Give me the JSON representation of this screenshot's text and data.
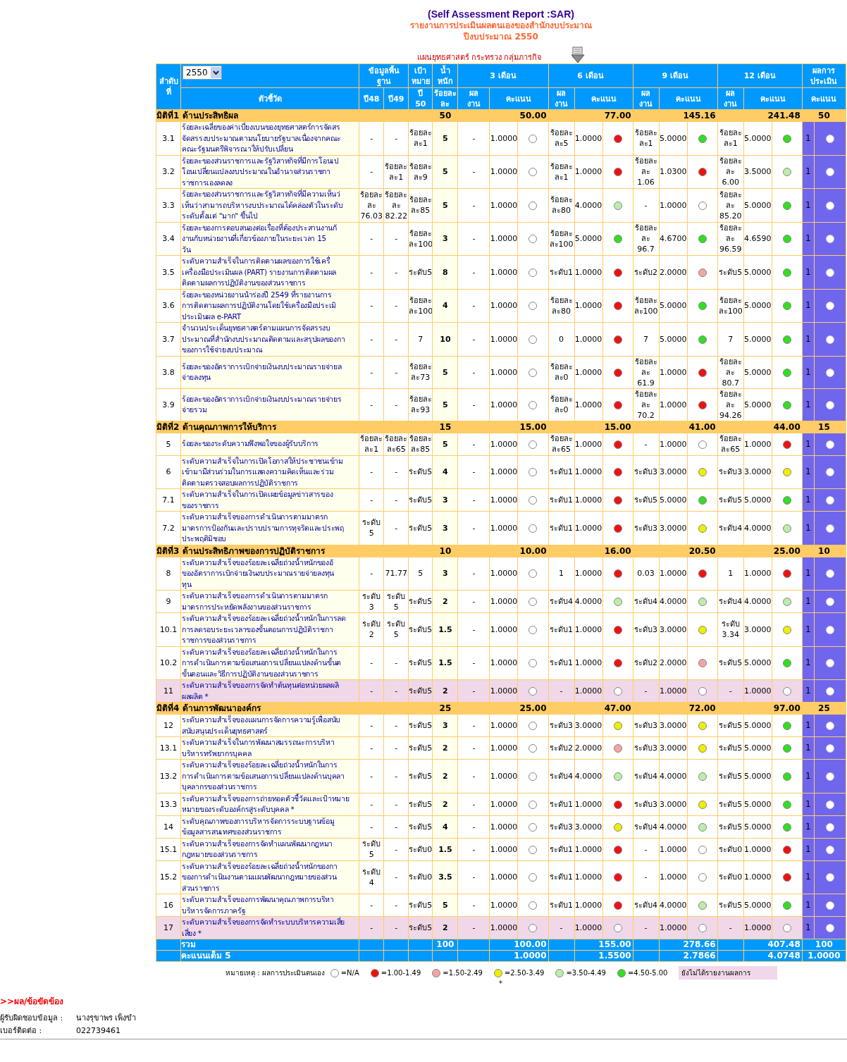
{
  "report": {
    "title": "(Self Assessment Report :SAR)",
    "subtitle": "รายงานการประเมินผลตนเองของสำนักงบประมาณ",
    "fiscal_year": "ปีงบประมาณ 2550",
    "organization": "แผนยุทธศาสตร์ กระทรวง กลุ่มภารกิจ"
  },
  "header": {
    "order": "ลำดับ\nที่",
    "year_select": "2550",
    "indicator": "ตัวชี้วัด",
    "baseline": "ข้อมูลพื้น\nฐาน",
    "baseline_years": [
      "ปี48",
      "ปี49"
    ],
    "target": "เป้า\nหมาย",
    "target_year": "ปี\n50",
    "weight": "น้ำหนัก",
    "weight_unit": "ร้อยละ\nละ",
    "evaluation": "ผลการ\nประเมิน",
    "evaluation_score": "คะแนน",
    "periods": [
      {
        "label": "3 เดือน",
        "result": "ผล\nงาน",
        "score": "คะแนน"
      },
      {
        "label": "6 เดือน",
        "result": "ผล\nงาน",
        "score": "คะแนน"
      },
      {
        "label": "9 เดือน",
        "result": "ผล\nงาน",
        "score": "คะแนน"
      },
      {
        "label": "12 เดือน",
        "result": "ผล\nงาน",
        "score": "คะแนน"
      }
    ]
  },
  "groups": [
    {
      "title": "มิติที่1 ด้านประสิทธิผล",
      "weight": "50",
      "totals": [
        "50.00",
        "77.00",
        "145.16",
        "241.48"
      ],
      "evaluation_total": "50",
      "rows": [
        {
          "no": "3.1",
          "indicator": "ร้อยละเฉลี่ยของค่าเบี่ยงเบนของยุทธศาสตร์การจัดสร\nจัดสรรงบประมาณตามนโยบายรัฐบาลเนื่องจากคณะ\nคณะรัฐมนตรีพิจารณาให้ปรับเปลี่ยน",
          "base_48": "-",
          "base_49": "-",
          "target": "ร้อยละ\nละ1",
          "weight": "5",
          "reported": true,
          "evaluation": "1",
          "evaluation_selected": false,
          "periods": [
            {
              "result": "-",
              "score": "1.0000",
              "color": "#ffffff"
            },
            {
              "result": "ร้อยละ\nละ5",
              "score": "1.0000",
              "color": "#ee1111"
            },
            {
              "result": "ร้อยละ\nละ1",
              "score": "5.0000",
              "color": "#33dd22"
            },
            {
              "result": "ร้อยละ\nละ1",
              "score": "5.0000",
              "color": "#33dd22"
            }
          ]
        },
        {
          "no": "3.2",
          "indicator": "ร้อยละของส่วนราชการและรัฐวิสาหกิจที่มีการโอนเป\nโอนเปลี่ยนแปลงงบประมาณในอำนาจส่วนราชกา\nราชการเองลดลง",
          "base_48": "-",
          "base_49": "ร้อยละ\nละ1",
          "target": "ร้อยละ\nละ9",
          "weight": "5",
          "reported": true,
          "evaluation": "1",
          "evaluation_selected": false,
          "periods": [
            {
              "result": "-",
              "score": "1.0000",
              "color": "#ffffff"
            },
            {
              "result": "ร้อยละ\nละ1",
              "score": "1.0000",
              "color": "#ee1111"
            },
            {
              "result": "ร้อยละ\nละ\n1.06",
              "score": "1.0300",
              "color": "#ee1111"
            },
            {
              "result": "ร้อยละ\nละ\n6.00",
              "score": "3.5000",
              "color": "#bbeeaa"
            }
          ]
        },
        {
          "no": "3.3",
          "indicator": "ร้อยละของส่วนราชการและรัฐวิสาหกิจที่มีความเห็นว่\nเห็นว่าสามารถบริหารงบประมาณได้คล่องตัวในระดับ\nระดับตั้งแต่ \"มาก\" ขึ้นไป",
          "base_48": "ร้อยละ\nละ\n76.03",
          "base_49": "ร้อยละ\nละ\n82.22",
          "target": "ร้อยละ\nละ85",
          "weight": "5",
          "reported": true,
          "evaluation": "1",
          "evaluation_selected": false,
          "periods": [
            {
              "result": "-",
              "score": "1.0000",
              "color": "#ffffff"
            },
            {
              "result": "ร้อยละ\nละ80",
              "score": "4.0000",
              "color": "#bbeeaa"
            },
            {
              "result": "-",
              "score": "1.0000",
              "color": "#ffffff"
            },
            {
              "result": "ร้อยละ\nละ\n85.20",
              "score": "5.0000",
              "color": "#33dd22"
            }
          ]
        },
        {
          "no": "3.4",
          "indicator": "ร้อยละของการตอบสนองต่อเรื่องที่ต้องประสานงานกั\nงานกับหน่วยงานที่เกี่ยวข้องภายในระยะเวลา 15\nวัน",
          "base_48": "-",
          "base_49": "-",
          "target": "ร้อยละ\nละ100",
          "weight": "3",
          "reported": true,
          "evaluation": "1",
          "evaluation_selected": false,
          "periods": [
            {
              "result": "-",
              "score": "1.0000",
              "color": "#ffffff"
            },
            {
              "result": "ร้อยละ\nละ100",
              "score": "5.0000",
              "color": "#33dd22"
            },
            {
              "result": "ร้อยละ\nละ\n96.7",
              "score": "4.6700",
              "color": "#33dd22"
            },
            {
              "result": "ร้อยละ\nละ\n96.59",
              "score": "4.6590",
              "color": "#33dd22"
            }
          ]
        },
        {
          "no": "3.5",
          "indicator": "ระดับความสำเร็จในการติดตามผลของการใช้เครื่\nเครื่องมือประเมินผล (PART) รายงานการติดตามผล\nติดตามผลการปฏิบัติงานของส่วนราชการ",
          "base_48": "-",
          "base_49": "-",
          "target": "ระดับ5",
          "weight": "8",
          "reported": true,
          "evaluation": "1",
          "evaluation_selected": false,
          "periods": [
            {
              "result": "-",
              "score": "1.0000",
              "color": "#ffffff"
            },
            {
              "result": "ระดับ1",
              "score": "1.0000",
              "color": "#ee1111"
            },
            {
              "result": "ระดับ2",
              "score": "2.0000",
              "color": "#f4a4a4"
            },
            {
              "result": "ระดับ5",
              "score": "5.0000",
              "color": "#33dd22"
            }
          ]
        },
        {
          "no": "3.6",
          "indicator": "ร้อยละของหน่วยงานนำร่องปี 2549 ที่รายงานการ\nการติดตามผลการปฏิบัติงานโดยใช้เครื่องมือประเมิ\nประเมินผล e-PART",
          "base_48": "-",
          "base_49": "-",
          "target": "ร้อยละ\nละ100",
          "weight": "4",
          "reported": true,
          "evaluation": "1",
          "evaluation_selected": false,
          "periods": [
            {
              "result": "-",
              "score": "1.0000",
              "color": "#ffffff"
            },
            {
              "result": "ร้อยละ\nละ80",
              "score": "1.0000",
              "color": "#ee1111"
            },
            {
              "result": "ร้อยละ\nละ100",
              "score": "5.0000",
              "color": "#33dd22"
            },
            {
              "result": "ร้อยละ\nละ100",
              "score": "5.0000",
              "color": "#33dd22"
            }
          ]
        },
        {
          "no": "3.7",
          "indicator": "จำนวนประเด็นยุทธศาสตร์ตามแผนการจัดสรรงบ\nประมาณที่สำนักงบประมาณติดตามและสรุปผลของกา\nของการใช้จ่ายงบประมาณ",
          "base_48": "-",
          "base_49": "-",
          "target": "7",
          "weight": "10",
          "reported": true,
          "evaluation": "1",
          "evaluation_selected": false,
          "periods": [
            {
              "result": "-",
              "score": "1.0000",
              "color": "#ffffff"
            },
            {
              "result": "0",
              "score": "1.0000",
              "color": "#ee1111"
            },
            {
              "result": "7",
              "score": "5.0000",
              "color": "#33dd22"
            },
            {
              "result": "7",
              "score": "5.0000",
              "color": "#33dd22"
            }
          ]
        },
        {
          "no": "3.8",
          "indicator": "ร้อยละของอัตราการเบิกจ่ายเงินงบประมาณรายจ่ายล\nจ่ายลงทุน",
          "base_48": "-",
          "base_49": "-",
          "target": "ร้อยละ\nละ73",
          "weight": "5",
          "reported": true,
          "evaluation": "1",
          "evaluation_selected": false,
          "periods": [
            {
              "result": "-",
              "score": "1.0000",
              "color": "#ffffff"
            },
            {
              "result": "ร้อยละ\nละ0",
              "score": "1.0000",
              "color": "#ee1111"
            },
            {
              "result": "ร้อยละ\nละ\n61.9",
              "score": "1.0000",
              "color": "#ee1111"
            },
            {
              "result": "ร้อยละ\nละ\n80.7",
              "score": "5.0000",
              "color": "#33dd22"
            }
          ]
        },
        {
          "no": "3.9",
          "indicator": "ร้อยละของอัตราการเบิกจ่ายเงินงบประมาณรายจ่ายร\nจ่ายรวม",
          "base_48": "-",
          "base_49": "-",
          "target": "ร้อยละ\nละ93",
          "weight": "5",
          "reported": true,
          "evaluation": "1",
          "evaluation_selected": false,
          "periods": [
            {
              "result": "-",
              "score": "1.0000",
              "color": "#ffffff"
            },
            {
              "result": "ร้อยละ\nละ0",
              "score": "1.0000",
              "color": "#ee1111"
            },
            {
              "result": "ร้อยละ\nละ\n70.2",
              "score": "1.0000",
              "color": "#ee1111"
            },
            {
              "result": "ร้อยละ\nละ\n94.26",
              "score": "5.0000",
              "color": "#33dd22"
            }
          ]
        }
      ]
    },
    {
      "title": "มิติที่2 ด้านคุณภาพการให้บริการ",
      "weight": "15",
      "totals": [
        "15.00",
        "15.00",
        "41.00",
        "44.00"
      ],
      "evaluation_total": "15",
      "rows": [
        {
          "no": "5",
          "indicator": "ร้อยละของระดับความพึงพอใจของผู้รับบริการ",
          "base_48": "ร้อยละ\nละ1",
          "base_49": "ร้อยละ\nละ65",
          "target": "ร้อยละ\nละ85",
          "weight": "5",
          "reported": true,
          "evaluation": "1",
          "evaluation_selected": false,
          "periods": [
            {
              "result": "-",
              "score": "1.0000",
              "color": "#ffffff"
            },
            {
              "result": "ร้อยละ\nละ65",
              "score": "1.0000",
              "color": "#ee1111"
            },
            {
              "result": "-",
              "score": "1.0000",
              "color": "#ffffff"
            },
            {
              "result": "ร้อยละ\nละ65",
              "score": "1.0000",
              "color": "#ee1111"
            }
          ]
        },
        {
          "no": "6",
          "indicator": "ระดับความสำเร็จในการเปิดโอกาสให้ประชาชนเข้าม\nเข้ามามีส่วนร่วมในการแสดงความคิดเห็นและร่วม\nติดตามตรวจสอบผลการปฏิบัติราชการ",
          "base_48": "-",
          "base_49": "-",
          "target": "ระดับ5",
          "weight": "4",
          "reported": true,
          "evaluation": "1",
          "evaluation_selected": false,
          "periods": [
            {
              "result": "-",
              "score": "1.0000",
              "color": "#ffffff"
            },
            {
              "result": "ระดับ1",
              "score": "1.0000",
              "color": "#ee1111"
            },
            {
              "result": "ระดับ3",
              "score": "3.0000",
              "color": "#eeee00"
            },
            {
              "result": "ระดับ3",
              "score": "3.0000",
              "color": "#eeee00"
            }
          ]
        },
        {
          "no": "7.1",
          "indicator": "ระดับความสำเร็จในการเปิดเผยข้อมูลข่าวสารของ\nของราชการ",
          "base_48": "-",
          "base_49": "-",
          "target": "ระดับ5",
          "weight": "3",
          "reported": true,
          "evaluation": "1",
          "evaluation_selected": false,
          "periods": [
            {
              "result": "-",
              "score": "1.0000",
              "color": "#ffffff"
            },
            {
              "result": "ระดับ1",
              "score": "1.0000",
              "color": "#ee1111"
            },
            {
              "result": "ระดับ5",
              "score": "5.0000",
              "color": "#33dd22"
            },
            {
              "result": "ระดับ5",
              "score": "5.0000",
              "color": "#33dd22"
            }
          ]
        },
        {
          "no": "7.2",
          "indicator": "ระดับความสำเร็จของการดำเนินการตามมาตรก\nมาตรการป้องกันและปราบปรามการทุจริตและประพฤ\nประพฤติมิชอบ",
          "base_48": "ระดับ\n5",
          "base_49": "-",
          "target": "ระดับ5",
          "weight": "3",
          "reported": true,
          "evaluation": "1",
          "evaluation_selected": false,
          "periods": [
            {
              "result": "-",
              "score": "1.0000",
              "color": "#ffffff"
            },
            {
              "result": "ระดับ1",
              "score": "1.0000",
              "color": "#ee1111"
            },
            {
              "result": "ระดับ3",
              "score": "3.0000",
              "color": "#eeee00"
            },
            {
              "result": "ระดับ4",
              "score": "4.0000",
              "color": "#bbeeaa"
            }
          ]
        }
      ]
    },
    {
      "title": "มิติที่3 ด้านประสิทธิภาพของการปฏิบัติราชการ",
      "weight": "10",
      "totals": [
        "10.00",
        "16.00",
        "20.50",
        "25.00"
      ],
      "evaluation_total": "10",
      "rows": [
        {
          "no": "8",
          "indicator": "ระดับความสำเร็จของร้อยละเฉลี่ยถ่วงน้ำหนักของอั\nของอัตราการเบิกจ่ายเงินงบประมาณรายจ่ายลงทุน\nทุน",
          "base_48": "-",
          "base_49": "71.77",
          "target": "5",
          "weight": "3",
          "reported": true,
          "evaluation": "1",
          "evaluation_selected": false,
          "periods": [
            {
              "result": "-",
              "score": "1.0000",
              "color": "#ffffff"
            },
            {
              "result": "1",
              "score": "1.0000",
              "color": "#ee1111"
            },
            {
              "result": "0.03",
              "score": "1.0000",
              "color": "#ee1111"
            },
            {
              "result": "1",
              "score": "1.0000",
              "color": "#ee1111"
            }
          ]
        },
        {
          "no": "9",
          "indicator": "ระดับความสำเร็จของการดำเนินการตามมาตรก\nมาตรการประหยัดพลังงานของส่วนราชการ",
          "base_48": "ระดับ\n3",
          "base_49": "ระดับ\n5",
          "target": "ระดับ5",
          "weight": "2",
          "reported": true,
          "evaluation": "1",
          "evaluation_selected": false,
          "periods": [
            {
              "result": "-",
              "score": "1.0000",
              "color": "#ffffff"
            },
            {
              "result": "ระดับ4",
              "score": "4.0000",
              "color": "#bbeeaa"
            },
            {
              "result": "ระดับ4",
              "score": "4.0000",
              "color": "#bbeeaa"
            },
            {
              "result": "ระดับ4",
              "score": "4.0000",
              "color": "#bbeeaa"
            }
          ]
        },
        {
          "no": "10.1",
          "indicator": "ระดับความสำเร็จของร้อยละเฉลี่ยถ่วงน้ำหนักในการลด\nการลดรอบระยะเวลาของขั้นตอนการปฏิบัติราชกา\nราชการของส่วนราชการ",
          "base_48": "ระดับ\n2",
          "base_49": "ระดับ\n5",
          "target": "ระดับ5",
          "weight": "1.5",
          "reported": true,
          "evaluation": "1",
          "evaluation_selected": false,
          "periods": [
            {
              "result": "-",
              "score": "1.0000",
              "color": "#ffffff"
            },
            {
              "result": "ระดับ1",
              "score": "1.0000",
              "color": "#ee1111"
            },
            {
              "result": "ระดับ3",
              "score": "3.0000",
              "color": "#eeee00"
            },
            {
              "result": "ระดับ\n3.34",
              "score": "3.0000",
              "color": "#eeee00"
            }
          ]
        },
        {
          "no": "10.2",
          "indicator": "ระดับความสำเร็จของร้อยละเฉลี่ยถ่วงน้ำหนักในการ\nการดำเนินการตามข้อเสนอการเปลี่ยนแปลงด้านขั้นต\nขั้นตอนและวิธีการปฏิบัติงานของส่วนราชการ",
          "base_48": "-",
          "base_49": "-",
          "target": "ระดับ5",
          "weight": "1.5",
          "reported": true,
          "evaluation": "1",
          "evaluation_selected": false,
          "periods": [
            {
              "result": "-",
              "score": "1.0000",
              "color": "#ffffff"
            },
            {
              "result": "ระดับ1",
              "score": "1.0000",
              "color": "#ee1111"
            },
            {
              "result": "ระดับ2",
              "score": "2.0000",
              "color": "#f4a4a4"
            },
            {
              "result": "ระดับ5",
              "score": "5.0000",
              "color": "#33dd22"
            }
          ]
        },
        {
          "no": "11",
          "indicator": "ระดับความสำเร็จของการจัดทำต้นทุนต่อหน่วยผลผลิ\nผลผลิต *",
          "base_48": "-",
          "base_49": "-",
          "target": "ระดับ5",
          "weight": "2",
          "reported": false,
          "evaluation": "1",
          "evaluation_selected": false,
          "periods": [
            {
              "result": "-",
              "score": "1.0000",
              "color": "#ffffff"
            },
            {
              "result": "-",
              "score": "1.0000",
              "color": "#ffffff"
            },
            {
              "result": "-",
              "score": "1.0000",
              "color": "#ffffff"
            },
            {
              "result": "-",
              "score": "1.0000",
              "color": "#ffffff"
            }
          ]
        }
      ]
    },
    {
      "title": "มิติที่4 ด้านการพัฒนาองค์กร",
      "weight": "25",
      "totals": [
        "25.00",
        "47.00",
        "72.00",
        "97.00"
      ],
      "evaluation_total": "25",
      "rows": [
        {
          "no": "12",
          "indicator": "ระดับความสำเร็จของแผนการจัดการความรู้เพื่อสนับ\nสนับสนุนประเด็นยุทธศาสตร์",
          "base_48": "-",
          "base_49": "-",
          "target": "ระดับ5",
          "weight": "3",
          "reported": true,
          "evaluation": "1",
          "evaluation_selected": false,
          "periods": [
            {
              "result": "-",
              "score": "1.0000",
              "color": "#ffffff"
            },
            {
              "result": "ระดับ3",
              "score": "3.0000",
              "color": "#eeee00"
            },
            {
              "result": "ระดับ3",
              "score": "3.0000",
              "color": "#eeee00"
            },
            {
              "result": "ระดับ5",
              "score": "5.0000",
              "color": "#33dd22"
            }
          ]
        },
        {
          "no": "13.1",
          "indicator": "ระดับความสำเร็จในการพัฒนาสมรรถนะการบริหา\nบริหารทรัพยากรบุคคล",
          "base_48": "-",
          "base_49": "-",
          "target": "ระดับ5",
          "weight": "2",
          "reported": true,
          "evaluation": "1",
          "evaluation_selected": false,
          "periods": [
            {
              "result": "-",
              "score": "1.0000",
              "color": "#ffffff"
            },
            {
              "result": "ระดับ2",
              "score": "2.0000",
              "color": "#f4a4a4"
            },
            {
              "result": "ระดับ3",
              "score": "3.0000",
              "color": "#eeee00"
            },
            {
              "result": "ระดับ5",
              "score": "5.0000",
              "color": "#33dd22"
            }
          ]
        },
        {
          "no": "13.2",
          "indicator": "ระดับความสำเร็จของร้อยละเฉลี่ยถ่วงน้ำหนักในการ\nการดำเนินการตามข้อเสนอการเปลี่ยนแปลงด้านบุคลา\nบุคลากรของส่วนราชการ",
          "base_48": "-",
          "base_49": "-",
          "target": "ระดับ5",
          "weight": "2",
          "reported": true,
          "evaluation": "1",
          "evaluation_selected": false,
          "periods": [
            {
              "result": "-",
              "score": "1.0000",
              "color": "#ffffff"
            },
            {
              "result": "ระดับ4",
              "score": "4.0000",
              "color": "#bbeeaa"
            },
            {
              "result": "ระดับ4",
              "score": "4.0000",
              "color": "#bbeeaa"
            },
            {
              "result": "ระดับ5",
              "score": "5.0000",
              "color": "#33dd22"
            }
          ]
        },
        {
          "no": "13.3",
          "indicator": "ระดับความสำเร็จของการถ่ายทอดตัวชี้วัดและเป้าหมาย\nหมายของระดับองค์กรสู่ระดับบุคคล *",
          "base_48": "-",
          "base_49": "-",
          "target": "ระดับ5",
          "weight": "2",
          "reported": true,
          "evaluation": "1",
          "evaluation_selected": false,
          "periods": [
            {
              "result": "-",
              "score": "1.0000",
              "color": "#ffffff"
            },
            {
              "result": "ระดับ1",
              "score": "1.0000",
              "color": "#ee1111"
            },
            {
              "result": "ระดับ3",
              "score": "3.0000",
              "color": "#eeee00"
            },
            {
              "result": "ระดับ5",
              "score": "5.0000",
              "color": "#33dd22"
            }
          ]
        },
        {
          "no": "14",
          "indicator": "ระดับคุณภาพของการบริหารจัดการระบบฐานข้อมู\nข้อมูลสารสนเทศของส่วนราชการ",
          "base_48": "-",
          "base_49": "-",
          "target": "ระดับ5",
          "weight": "4",
          "reported": true,
          "evaluation": "1",
          "evaluation_selected": false,
          "periods": [
            {
              "result": "-",
              "score": "1.0000",
              "color": "#ffffff"
            },
            {
              "result": "ระดับ3",
              "score": "3.0000",
              "color": "#eeee00"
            },
            {
              "result": "ระดับ4",
              "score": "4.0000",
              "color": "#bbeeaa"
            },
            {
              "result": "ระดับ5",
              "score": "5.0000",
              "color": "#33dd22"
            }
          ]
        },
        {
          "no": "15.1",
          "indicator": "ระดับความสำเร็จของการจัดทำแผนพัฒนากฎหมา\nกฎหมายของส่วนราชการ",
          "base_48": "ระดับ\n5",
          "base_49": "-",
          "target": "ระดับ0",
          "weight": "1.5",
          "reported": true,
          "evaluation": "1",
          "evaluation_selected": false,
          "periods": [
            {
              "result": "-",
              "score": "1.0000",
              "color": "#ffffff"
            },
            {
              "result": "ระดับ1",
              "score": "1.0000",
              "color": "#ee1111"
            },
            {
              "result": "-",
              "score": "1.0000",
              "color": "#ffffff"
            },
            {
              "result": "ระดับ0",
              "score": "1.0000",
              "color": "#ee1111"
            }
          ]
        },
        {
          "no": "15.2",
          "indicator": "ระดับความสำเร็จของร้อยละเฉลี่ยถ่วงน้ำหนักของกา\nของการดำเนินงานตามแผนพัฒนากฎหมายของส่วน\nส่วนราชการ",
          "base_48": "ระดับ\n4",
          "base_49": "-",
          "target": "ระดับ0",
          "weight": "3.5",
          "reported": true,
          "evaluation": "1",
          "evaluation_selected": false,
          "periods": [
            {
              "result": "-",
              "score": "1.0000",
              "color": "#ffffff"
            },
            {
              "result": "ระดับ1",
              "score": "1.0000",
              "color": "#ee1111"
            },
            {
              "result": "-",
              "score": "1.0000",
              "color": "#ffffff"
            },
            {
              "result": "ระดับ0",
              "score": "1.0000",
              "color": "#ee1111"
            }
          ]
        },
        {
          "no": "16",
          "indicator": "ระดับความสำเร็จของการพัฒนาคุณภาพการบริหา\nบริหารจัดการภาครัฐ",
          "base_48": "-",
          "base_49": "-",
          "target": "ระดับ5",
          "weight": "5",
          "reported": true,
          "evaluation": "1",
          "evaluation_selected": false,
          "periods": [
            {
              "result": "-",
              "score": "1.0000",
              "color": "#ffffff"
            },
            {
              "result": "ระดับ1",
              "score": "1.0000",
              "color": "#ee1111"
            },
            {
              "result": "ระดับ4",
              "score": "4.0000",
              "color": "#bbeeaa"
            },
            {
              "result": "ระดับ5",
              "score": "5.0000",
              "color": "#33dd22"
            }
          ]
        },
        {
          "no": "17",
          "indicator": "ระดับความสำเร็จของการจัดทำระบบบริหารความเสี่ย\nเสี่ยง *",
          "base_48": "-",
          "base_49": "-",
          "target": "ระดับ5",
          "weight": "2",
          "reported": false,
          "evaluation": "1",
          "evaluation_selected": false,
          "periods": [
            {
              "result": "-",
              "score": "1.0000",
              "color": "#ffffff"
            },
            {
              "result": "-",
              "score": "1.0000",
              "color": "#ffffff"
            },
            {
              "result": "-",
              "score": "1.0000",
              "color": "#ffffff"
            },
            {
              "result": "-",
              "score": "1.0000",
              "color": "#ffffff"
            }
          ]
        }
      ]
    }
  ],
  "totals": [
    {
      "label": "รวม",
      "weight": "100",
      "periods": [
        "100.00",
        "155.00",
        "278.66",
        "407.48"
      ],
      "evaluation": "100"
    },
    {
      "label": "คะแนนเต็ม 5",
      "periods": [
        "1.0000",
        "1.5500",
        "2.7866",
        "4.0748"
      ],
      "evaluation": "1.0000"
    }
  ],
  "legend": {
    "label": "หมายเหตุ : ผลการประเมินตนเอง",
    "items": [
      {
        "label": "=N/A",
        "color": "#ffffff"
      },
      {
        "label": "=1.00-1.49",
        "color": "#ee1111"
      },
      {
        "label": "=1.50-2.49",
        "color": "#f4a4a4"
      },
      {
        "label": "=2.50-3.49",
        "color": "#eeee00"
      },
      {
        "label": "=3.50-4.49",
        "color": "#bbeeaa"
      },
      {
        "label": "=4.50-5.00",
        "color": "#33dd22"
      }
    ],
    "not_reported": "ยังไม่ได้รายงานผลการ",
    "footnote": "*"
  },
  "contact": {
    "heading": ">>ผล/ข้อขัดข้อง",
    "fields": [
      {
        "label": "ผู้รับผิดชอบข้อมูล :",
        "value": "นางรุขาพร เพ็งขำ"
      },
      {
        "label": "เบอร์ติดต่อ :",
        "value": "022739461"
      }
    ]
  }
}
